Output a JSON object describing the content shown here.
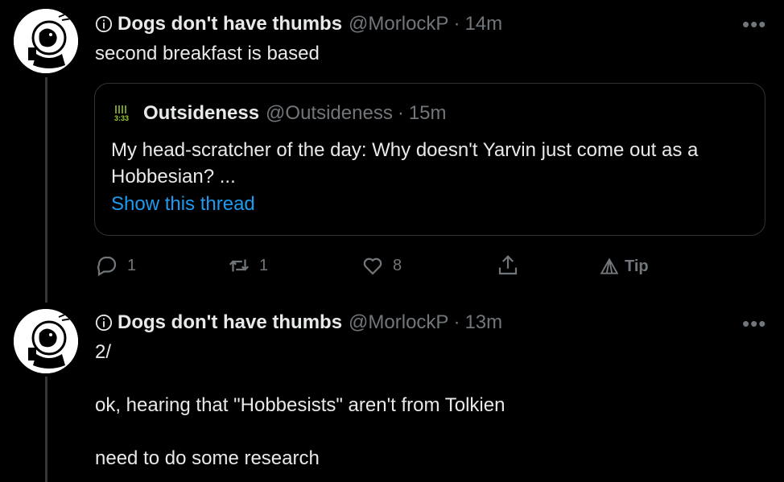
{
  "tweets": [
    {
      "name": "Dogs don't have thumbs",
      "handle": "@MorlockP",
      "separator": "·",
      "time": "14m",
      "text": "second breakfast is based",
      "more": "•••",
      "quote": {
        "avatar_text": "3:33",
        "name": "Outsideness",
        "handle": "@Outsideness",
        "separator": "·",
        "time": "15m",
        "text": "My head-scratcher of the day: Why doesn't Yarvin just come out as a Hobbesian? ...",
        "link": "Show this thread"
      },
      "actions": {
        "replies": "1",
        "retweets": "1",
        "likes": "8",
        "tip": "Tip"
      }
    },
    {
      "name": "Dogs don't have thumbs",
      "handle": "@MorlockP",
      "separator": "·",
      "time": "13m",
      "text": "2/\n\nok, hearing that \"Hobbesists\" aren't from Tolkien\n\nneed to do some research",
      "more": "•••"
    }
  ],
  "colors": {
    "background": "#000000",
    "text": "#e7e9ea",
    "secondary": "#71767b",
    "link": "#1d9bf0",
    "border": "#2f3336"
  }
}
